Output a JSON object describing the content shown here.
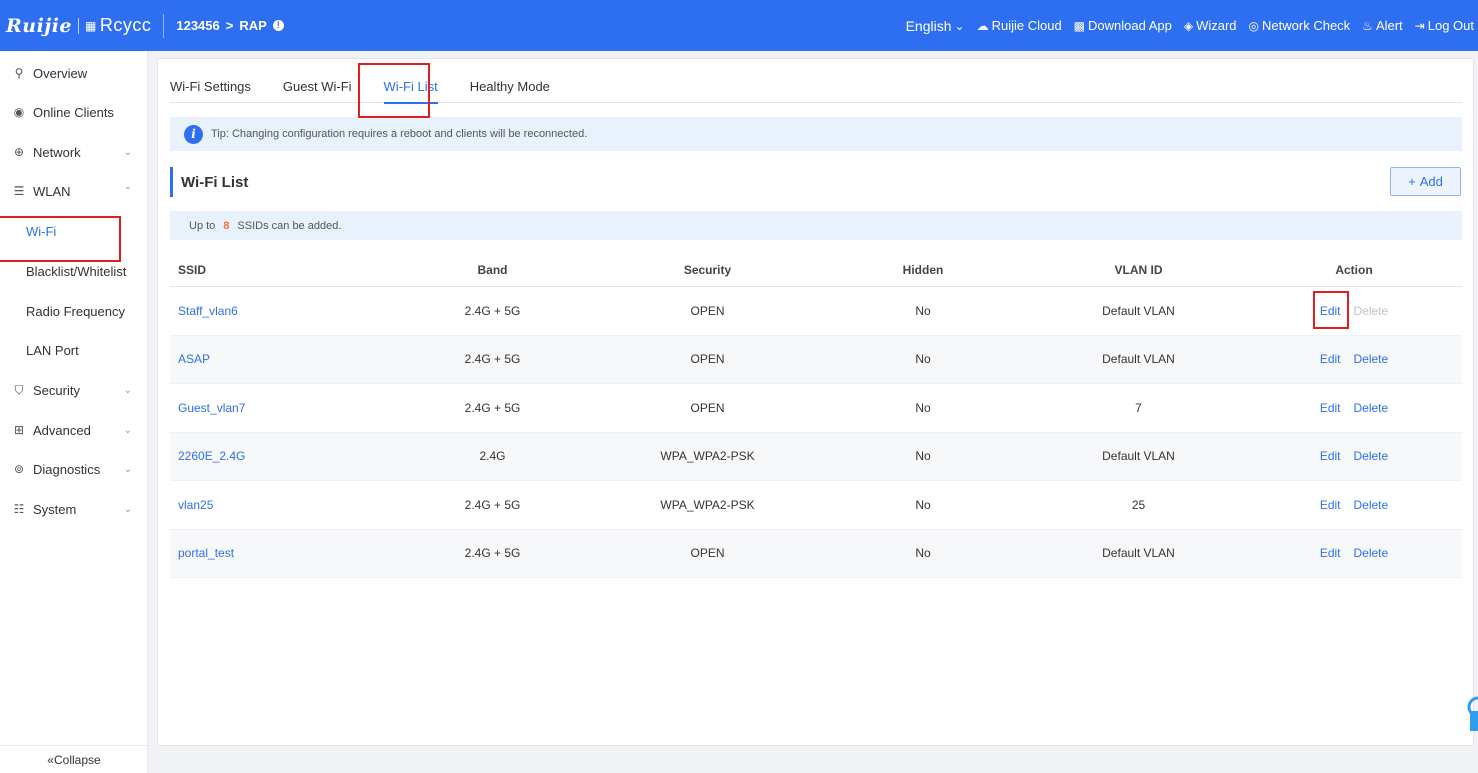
{
  "header": {
    "brand_ruijie": "Ruijie",
    "brand_reyee": "Rcycc",
    "project": "123456",
    "crumb_sep": ">",
    "device": "RAP",
    "language": "English",
    "items": [
      {
        "label": "Ruijie Cloud",
        "icon": "cloud-icon"
      },
      {
        "label": "Download App",
        "icon": "qr-code-icon"
      },
      {
        "label": "Wizard",
        "icon": "wizard-icon"
      },
      {
        "label": "Network Check",
        "icon": "network-check-icon"
      },
      {
        "label": "Alert",
        "icon": "alert-icon"
      },
      {
        "label": "Log Out",
        "icon": "logout-icon"
      }
    ]
  },
  "sidebar": {
    "items": [
      {
        "label": "Overview",
        "icon": "overview-icon"
      },
      {
        "label": "Online Clients",
        "icon": "clients-icon"
      },
      {
        "label": "Network",
        "icon": "globe-icon"
      },
      {
        "label": "WLAN",
        "icon": "wifi-icon"
      },
      {
        "label": "Wi-Fi"
      },
      {
        "label": "Blacklist/Whitelist"
      },
      {
        "label": "Radio Frequency"
      },
      {
        "label": "LAN Port"
      },
      {
        "label": "Security",
        "icon": "shield-icon"
      },
      {
        "label": "Advanced",
        "icon": "advanced-icon"
      },
      {
        "label": "Diagnostics",
        "icon": "diagnostics-icon"
      },
      {
        "label": "System",
        "icon": "system-icon"
      }
    ],
    "collapse": "Collapse"
  },
  "tabs": [
    "Wi-Fi Settings",
    "Guest Wi-Fi",
    "Wi-Fi List",
    "Healthy Mode"
  ],
  "tip": "Tip: Changing configuration requires a reboot and clients will be reconnected.",
  "section_title": "Wi-Fi List",
  "add_label": "Add",
  "limit": {
    "prefix": "Up to",
    "count": "8",
    "suffix": "SSIDs can be added."
  },
  "table": {
    "headers": [
      "SSID",
      "Band",
      "Security",
      "Hidden",
      "VLAN ID",
      "Action"
    ],
    "edit_label": "Edit",
    "delete_label": "Delete",
    "rows": [
      {
        "ssid": "Staff_vlan6",
        "band": "2.4G + 5G",
        "security": "OPEN",
        "hidden": "No",
        "vlan": "Default VLAN"
      },
      {
        "ssid": "ASAP",
        "band": "2.4G + 5G",
        "security": "OPEN",
        "hidden": "No",
        "vlan": "Default VLAN"
      },
      {
        "ssid": "Guest_vlan7",
        "band": "2.4G + 5G",
        "security": "OPEN",
        "hidden": "No",
        "vlan": "7"
      },
      {
        "ssid": "2260E_2.4G",
        "band": "2.4G",
        "security": "WPA_WPA2-PSK",
        "hidden": "No",
        "vlan": "Default VLAN"
      },
      {
        "ssid": "vlan25",
        "band": "2.4G + 5G",
        "security": "WPA_WPA2-PSK",
        "hidden": "No",
        "vlan": "25"
      },
      {
        "ssid": "portal_test",
        "band": "2.4G + 5G",
        "security": "OPEN",
        "hidden": "No",
        "vlan": "Default VLAN"
      }
    ]
  },
  "colors": {
    "accent": "#2e6ff2",
    "highlight_box": "#e02020",
    "count": "#f5722e"
  }
}
